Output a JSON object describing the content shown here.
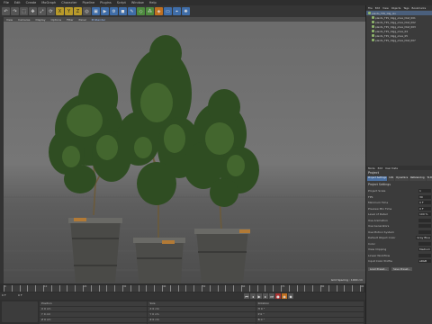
{
  "menu": [
    "File",
    "Edit",
    "Create",
    "MoGraph",
    "Character",
    "Pipeline",
    "Plugins",
    "Script",
    "Window",
    "Help"
  ],
  "toolbar": {
    "icons": [
      "undo-icon",
      "redo-icon",
      "select-icon",
      "move-icon",
      "scale-icon",
      "rotate-icon",
      "x-axis-icon",
      "y-axis-icon",
      "z-axis-icon",
      "world-icon",
      "render-view-icon",
      "render-icon",
      "render-settings-icon",
      "cube-icon",
      "pen-icon",
      "subdivision-icon",
      "array-icon",
      "deformer-icon",
      "floor-icon",
      "camera-icon",
      "light-icon"
    ]
  },
  "viewport": {
    "menu": [
      "View",
      "Cameras",
      "Display",
      "Options",
      "Filter",
      "Panel",
      "ProRender"
    ],
    "active_menu_index": 6
  },
  "object_manager": {
    "menu": [
      "File",
      "Edit",
      "View",
      "Objects",
      "Tags",
      "Bookmarks"
    ],
    "items": [
      "plants_TP1_Olg_olv",
      "plants_TP1_Olgg_olive_Dist_001",
      "plants_TP1_Olgg_olive_Dist_002",
      "plants_TP1_Olgg_olive_Dist_003",
      "plants_TP1_Olgg_olive_04",
      "plants_TP1_Olgg_olive_05",
      "plants_TP1_Olgg_olive_Dist_007"
    ]
  },
  "attributes": {
    "menu": [
      "Mode",
      "Edit",
      "User Data"
    ],
    "title": "Project",
    "tabs": [
      "Project Settings",
      "Info",
      "Dynamics",
      "Referencing",
      "To Do"
    ],
    "section": "Project Settings",
    "fields": [
      {
        "label": "Project Scale",
        "value": "1"
      },
      {
        "label": "FPS",
        "value": "30"
      },
      {
        "label": "Minimum Time",
        "value": "0 F"
      },
      {
        "label": "Preview Min Time",
        "value": "0 F"
      },
      {
        "label": "Level of Detail",
        "value": "100 %"
      },
      {
        "label": "Use Animation",
        "value": ""
      },
      {
        "label": "Use Generators",
        "value": ""
      },
      {
        "label": "Use Motion System",
        "value": ""
      },
      {
        "label": "Default Object Color",
        "value": "Gray Blue"
      },
      {
        "label": "Color",
        "value": ""
      },
      {
        "label": "View Clipping",
        "value": "Medium"
      },
      {
        "label": "Linear Workflow",
        "value": ""
      },
      {
        "label": "Input Color Profile",
        "value": "sRGB"
      }
    ],
    "buttons": [
      "Load Preset...",
      "Save Preset..."
    ]
  },
  "viewport_info": "Grid Spacing : 1000 cm",
  "timeline": {
    "ticks": [
      0,
      2,
      4,
      6,
      8,
      10,
      12,
      14,
      16,
      18,
      20,
      22,
      24,
      26,
      28,
      30,
      32,
      34,
      36,
      38,
      40,
      42,
      44,
      46,
      48,
      50,
      52,
      54,
      56,
      58,
      60,
      62,
      64,
      66,
      68,
      70,
      72,
      74,
      76,
      78,
      80,
      82,
      84,
      86,
      88,
      90
    ],
    "current": "0 F",
    "start": "0 F",
    "end": "90 F"
  },
  "coords": {
    "headers": [
      "Position",
      "Size",
      "Rotation"
    ],
    "rows": [
      [
        "X 0 cm",
        "X 0 cm",
        "H 0 °"
      ],
      [
        "Y 0 cm",
        "Y 0 cm",
        "P 0 °"
      ],
      [
        "Z 0 cm",
        "Z 0 cm",
        "B 0 °"
      ]
    ],
    "mode": "Object (Rel)",
    "apply": "Apply"
  }
}
